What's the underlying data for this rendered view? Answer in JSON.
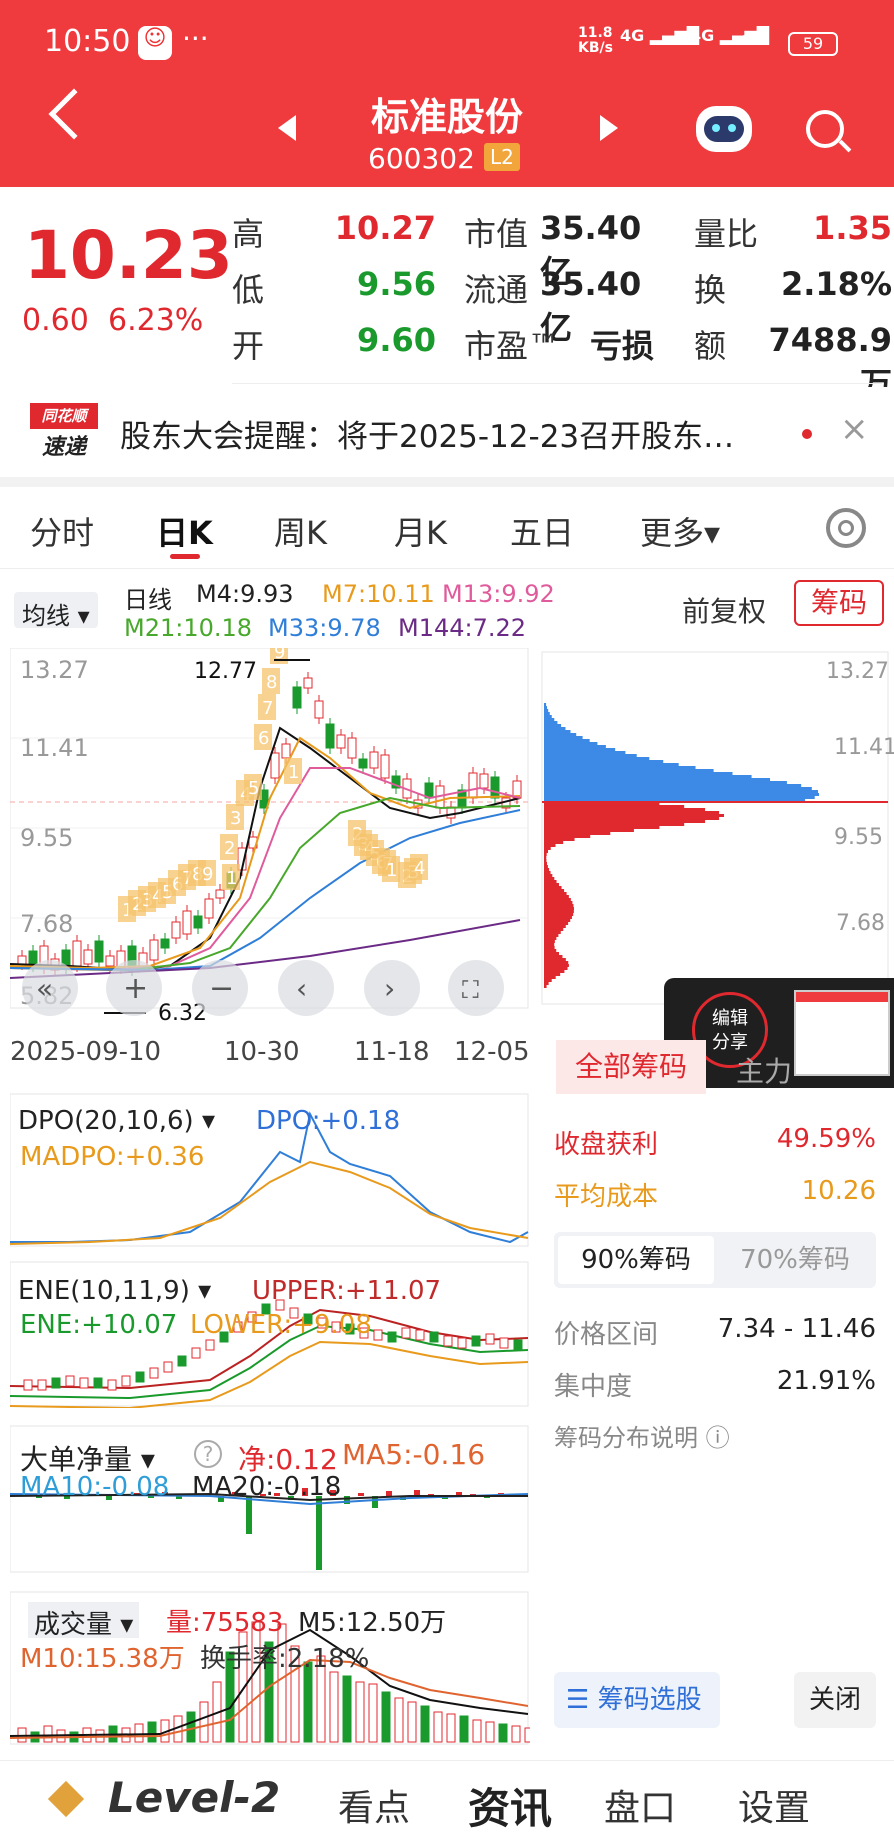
{
  "status_bar": {
    "time": "10:50",
    "dots": "···",
    "net_speed": "11.8\nKB/s",
    "signal1": "4G",
    "signal2": "4G",
    "battery": "59"
  },
  "header": {
    "title": "标准股份",
    "code": "600302",
    "badge": "L2"
  },
  "quote": {
    "price": "10.23",
    "change": "0.60",
    "change_pct": "6.23%",
    "rows": [
      {
        "l1": "高",
        "v1": "10.27",
        "l2": "市值",
        "v2": "35.40亿",
        "l3": "量比",
        "v3": "1.35"
      },
      {
        "l1": "低",
        "v1": "9.56",
        "l2": "流通",
        "v2": "35.40亿",
        "l3": "换",
        "v3": "2.18%"
      },
      {
        "l1": "开",
        "v1": "9.60",
        "l2": "市盈™",
        "v2": "亏损",
        "l3": "额",
        "v3": "7488.9万"
      }
    ]
  },
  "notice": {
    "logo_top": "同花顺",
    "logo_bottom": "速递",
    "text": "股东大会提醒：将于2025-12-23召开股东…"
  },
  "tabs": [
    "分时",
    "日K",
    "周K",
    "月K",
    "五日",
    "更多▾"
  ],
  "kline": {
    "ma_select": "均线",
    "period": "日线",
    "m4": "M4:9.93",
    "m7": "M7:10.11",
    "m13": "M13:9.92",
    "m21": "M21:10.18",
    "m33": "M33:9.78",
    "m144": "M144:7.22",
    "fuquan": "前复权",
    "chouma": "筹码",
    "y_ticks": [
      "13.27",
      "11.41",
      "9.55",
      "7.68",
      "5.82"
    ],
    "x_ticks": [
      "2025-09-10",
      "10-30",
      "11-18",
      "12-05"
    ],
    "high_mark": "12.77",
    "low_mark": "6.32",
    "td_labels": [
      "1",
      "2",
      "3",
      "4",
      "5",
      "6",
      "7",
      "8",
      "9",
      "1",
      "2",
      "3",
      "4",
      "5",
      "6",
      "7",
      "8",
      "9",
      "1",
      "2",
      "3",
      "4",
      "5",
      "6",
      "7",
      "1",
      "2",
      "3",
      "4",
      "5",
      "6",
      "7",
      "8",
      "9"
    ]
  },
  "chips": {
    "tabs": [
      "全部筹码",
      "主力"
    ],
    "profit_label": "收盘获利",
    "profit_val": "49.59%",
    "cost_label": "平均成本",
    "cost_val": "10.26",
    "sub_tabs": [
      "90%筹码",
      "70%筹码"
    ],
    "range_label": "价格区间",
    "range_val": "7.34 - 11.46",
    "conc_label": "集中度",
    "conc_val": "21.91%",
    "help": "筹码分布说明",
    "select_btn": "筹码选股",
    "close_btn": "关闭"
  },
  "share": {
    "line1": "编辑",
    "line2": "分享"
  },
  "dpo": {
    "name": "DPO(20,10,6)",
    "dpo": "DPO:+0.18",
    "madpo": "MADPO:+0.36"
  },
  "ene": {
    "name": "ENE(10,11,9)",
    "upper": "UPPER:+11.07",
    "ene": "ENE:+10.07",
    "lower": "LOWER:+9.08"
  },
  "ddj": {
    "name": "大单净量",
    "net": "净:0.12",
    "ma5": "MA5:-0.16",
    "ma10": "MA10:-0.08",
    "ma20": "MA20:-0.18"
  },
  "vol": {
    "name": "成交量",
    "q": "量:75583",
    "m5": "M5:12.50万",
    "m10": "M10:15.38万",
    "turnover": "换手率:2.18%"
  },
  "bottom": [
    "Level-2",
    "看点",
    "资讯",
    "盘口",
    "设置"
  ],
  "colors": {
    "red": "#e0282f",
    "green": "#1a9a2c",
    "header": "#ef3a3e",
    "blue": "#2f7ed8",
    "orange": "#e89a1c"
  }
}
